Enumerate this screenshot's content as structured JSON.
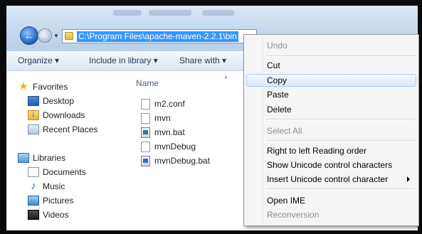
{
  "address": {
    "path": "C:\\Program Files\\apache-maven-2.2.1\\bin"
  },
  "toolbar": {
    "organize": "Organize ▾",
    "include_in_library": "Include in library ▾",
    "share_with": "Share with ▾"
  },
  "nav": {
    "favorites": {
      "label": "Favorites",
      "items": [
        "Desktop",
        "Downloads",
        "Recent Places"
      ]
    },
    "libraries": {
      "label": "Libraries",
      "items": [
        "Documents",
        "Music",
        "Pictures",
        "Videos"
      ]
    }
  },
  "content": {
    "column_name": "Name",
    "files": [
      "m2.conf",
      "mvn",
      "mvn.bat",
      "mvnDebug",
      "mvnDebug.bat"
    ]
  },
  "context_menu": {
    "items": [
      {
        "label": "Undo",
        "state": "disabled"
      },
      {
        "label": "Cut",
        "state": "enabled"
      },
      {
        "label": "Copy",
        "state": "hover"
      },
      {
        "label": "Paste",
        "state": "enabled"
      },
      {
        "label": "Delete",
        "state": "enabled"
      },
      {
        "label": "Select All",
        "state": "disabled"
      },
      {
        "label": "Right to left Reading order",
        "state": "enabled"
      },
      {
        "label": "Show Unicode control characters",
        "state": "enabled"
      },
      {
        "label": "Insert Unicode control character",
        "state": "enabled",
        "submenu": true
      },
      {
        "label": "Open IME",
        "state": "enabled"
      },
      {
        "label": "Reconversion",
        "state": "disabled"
      }
    ]
  },
  "icons": {
    "back": "back-arrow-icon",
    "forward": "forward-arrow-icon",
    "folder": "folder-icon"
  },
  "colors": {
    "selection": "#3399ff",
    "menu_hover_border": "#aecff7"
  }
}
